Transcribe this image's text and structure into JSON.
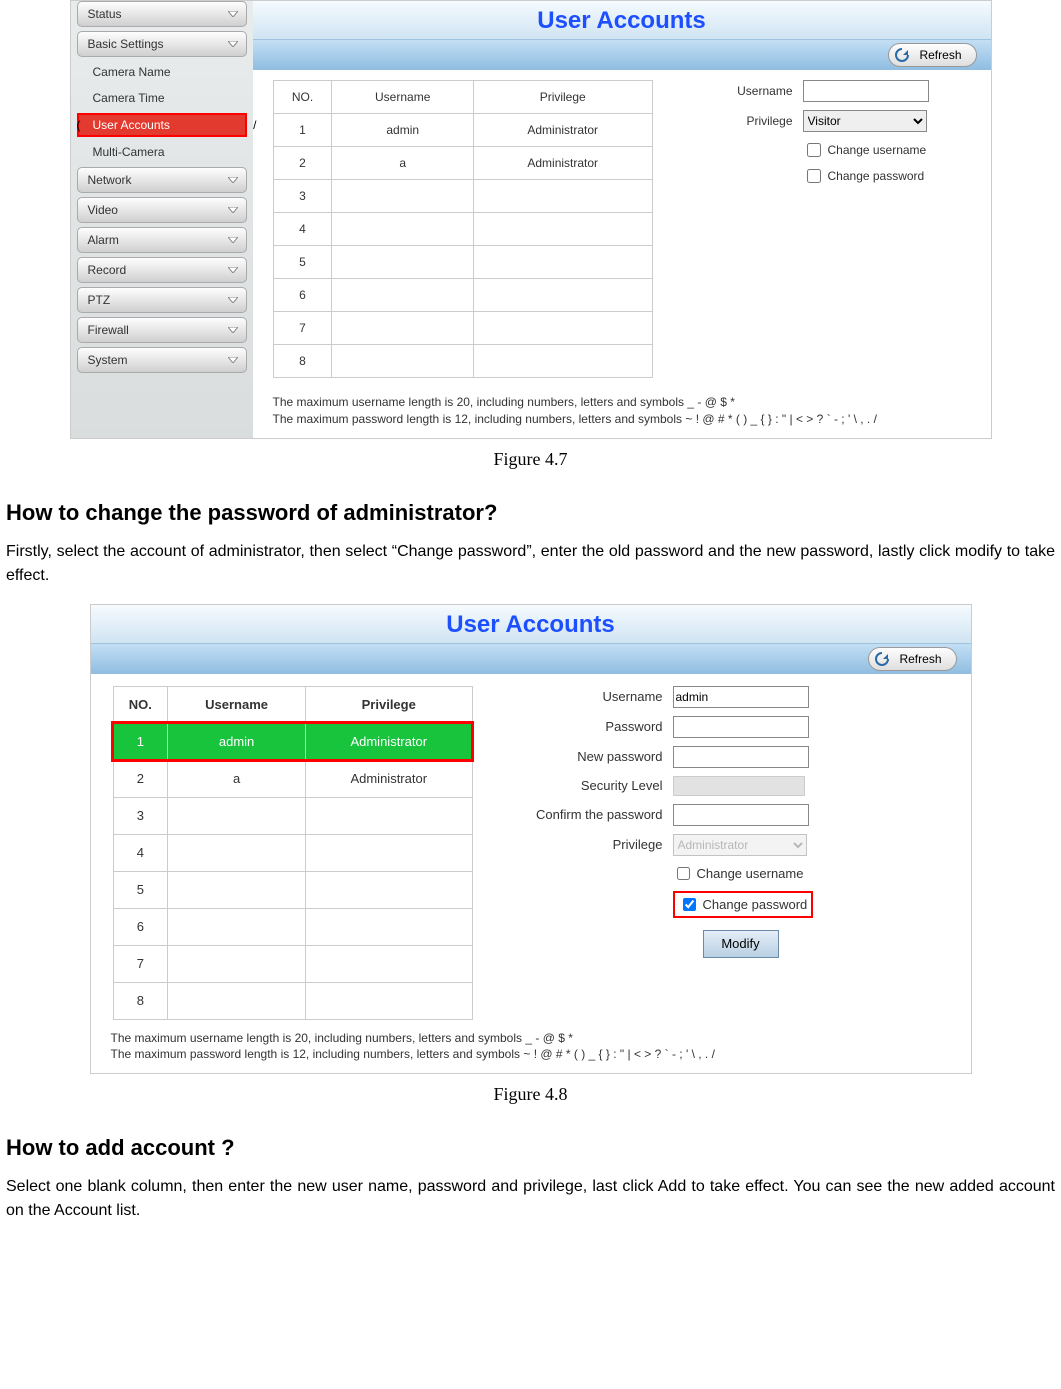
{
  "fig47": {
    "sidebar": {
      "buttons_top": [
        "Status",
        "Basic Settings"
      ],
      "links": [
        "Camera Name",
        "Camera Time",
        "User Accounts",
        "Multi-Camera"
      ],
      "selected_index": 2,
      "buttons_bottom": [
        "Network",
        "Video",
        "Alarm",
        "Record",
        "PTZ",
        "Firewall",
        "System"
      ]
    },
    "title": "User Accounts",
    "refresh": "Refresh",
    "table": {
      "headers": [
        "NO.",
        "Username",
        "Privilege"
      ],
      "rows": [
        {
          "no": "1",
          "user": "admin",
          "priv": "Administrator"
        },
        {
          "no": "2",
          "user": "a",
          "priv": "Administrator"
        },
        {
          "no": "3",
          "user": "",
          "priv": ""
        },
        {
          "no": "4",
          "user": "",
          "priv": ""
        },
        {
          "no": "5",
          "user": "",
          "priv": ""
        },
        {
          "no": "6",
          "user": "",
          "priv": ""
        },
        {
          "no": "7",
          "user": "",
          "priv": ""
        },
        {
          "no": "8",
          "user": "",
          "priv": ""
        }
      ]
    },
    "form": {
      "username_label": "Username",
      "username_value": "",
      "privilege_label": "Privilege",
      "privilege_value": "Visitor",
      "change_username": "Change username",
      "change_password": "Change password"
    },
    "hint1": "The maximum username length is 20, including numbers, letters and symbols _ - @ $ *",
    "hint2": "The maximum password length is 12, including numbers, letters and symbols ~ ! @ # * ( ) _ { } : \" | < > ? ` - ; ' \\ , . /",
    "caption": "Figure 4.7"
  },
  "section1": {
    "heading": "How to change the password of administrator?",
    "para": "Firstly, select the account of administrator, then select “Change password”, enter the old password and the new password, lastly click modify to take effect."
  },
  "fig48": {
    "title": "User Accounts",
    "refresh": "Refresh",
    "table": {
      "headers": [
        "NO.",
        "Username",
        "Privilege"
      ],
      "rows": [
        {
          "no": "1",
          "user": "admin",
          "priv": "Administrator",
          "selected": true
        },
        {
          "no": "2",
          "user": "a",
          "priv": "Administrator"
        },
        {
          "no": "3",
          "user": "",
          "priv": ""
        },
        {
          "no": "4",
          "user": "",
          "priv": ""
        },
        {
          "no": "5",
          "user": "",
          "priv": ""
        },
        {
          "no": "6",
          "user": "",
          "priv": ""
        },
        {
          "no": "7",
          "user": "",
          "priv": ""
        },
        {
          "no": "8",
          "user": "",
          "priv": ""
        }
      ]
    },
    "form": {
      "username_label": "Username",
      "username_value": "admin",
      "password_label": "Password",
      "newpassword_label": "New password",
      "security_label": "Security Level",
      "confirm_label": "Confirm the password",
      "privilege_label": "Privilege",
      "privilege_value": "Administrator",
      "change_username": "Change username",
      "change_password": "Change password",
      "modify": "Modify"
    },
    "hint1": "The maximum username length is 20, including numbers, letters and symbols _ - @ $ *",
    "hint2": "The maximum password length is 12, including numbers, letters and symbols ~ ! @ # * ( ) _ { } : \" | < > ? ` - ; ' \\ , . /",
    "caption": "Figure 4.8"
  },
  "section2": {
    "heading": "How to add account ?",
    "para": "Select one blank column, then enter the new user name, password and privilege, last click Add to take effect. You can see the new added account on the Account list."
  }
}
